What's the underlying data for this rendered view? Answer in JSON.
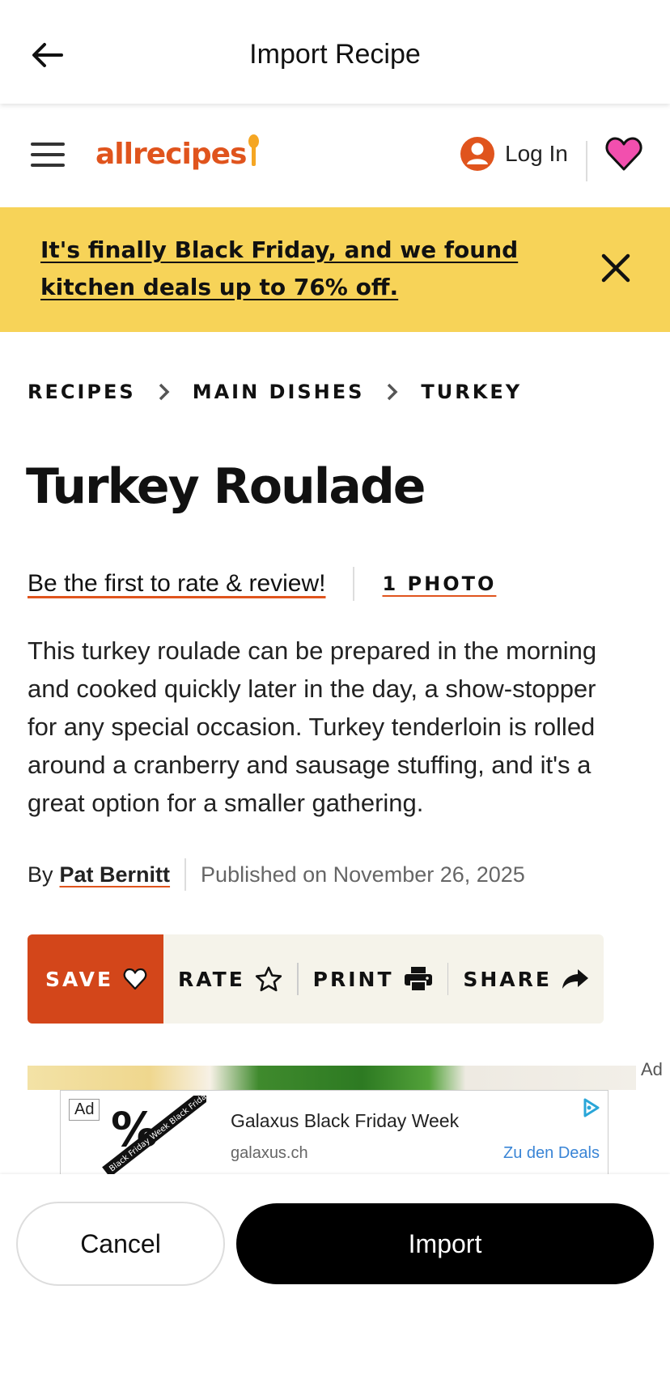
{
  "appbar": {
    "title": "Import Recipe"
  },
  "site": {
    "logo_text": "allrecipes",
    "login_label": "Log In"
  },
  "banner": {
    "text": "It's finally Black Friday, and we found kitchen deals up to 76% off."
  },
  "breadcrumb": [
    "RECIPES",
    "MAIN DISHES",
    "TURKEY"
  ],
  "recipe": {
    "title": "Turkey Roulade",
    "rate_prompt": "Be the first to rate & review!",
    "photo_count": "1 PHOTO",
    "description": "This turkey roulade can be prepared in the morning and cooked quickly later in the day, a show-stopper for any special occasion. Turkey tenderloin is rolled around a cranberry and sausage stuffing, and it's a great option for a smaller gathering.",
    "by_label": "By",
    "author": "Pat Bernitt",
    "published": "Published on November 26, 2025"
  },
  "actions": {
    "save": "SAVE",
    "rate": "RATE",
    "print": "PRINT",
    "share": "SHARE"
  },
  "ad": {
    "corner_label": "Ad",
    "badge": "Ad",
    "title": "Galaxus Black Friday Week",
    "domain": "galaxus.ch",
    "cta": "Zu den Deals",
    "graphic_text": "Black Friday Week Black Friday Wee"
  },
  "bottom": {
    "cancel": "Cancel",
    "import": "Import"
  },
  "colors": {
    "brand": "#e0541d",
    "banner": "#f7d358",
    "save_button": "#d3461a",
    "action_bar": "#f5f3ea",
    "ad_link": "#3a85d6"
  }
}
